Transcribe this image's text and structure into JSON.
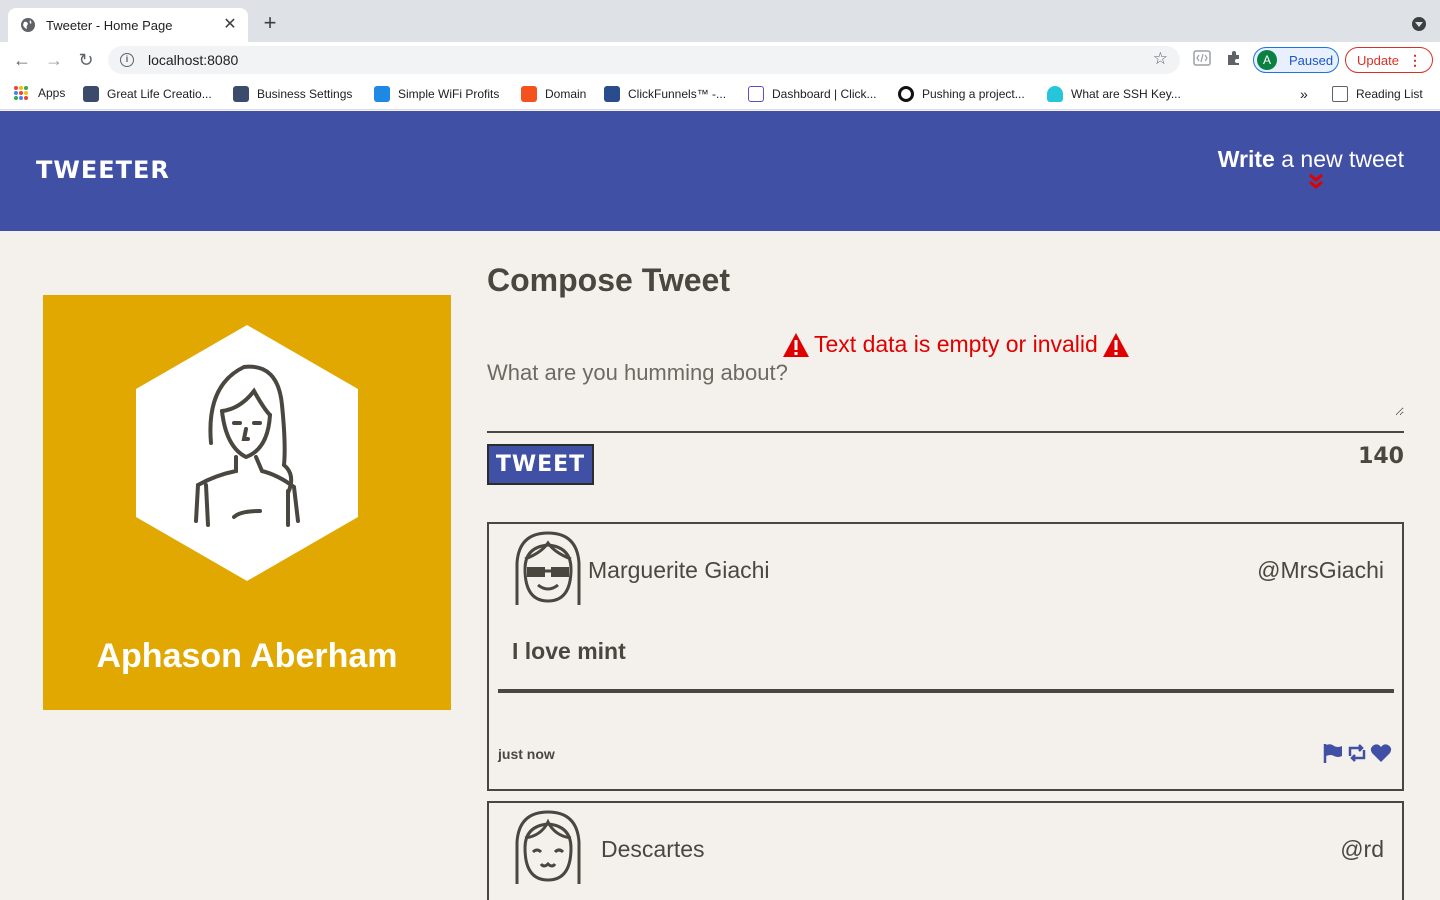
{
  "browser": {
    "tab_title": "Tweeter - Home Page",
    "url": "localhost:8080",
    "profile_initial": "A",
    "profile_status": "Paused",
    "update_label": "Update",
    "bookmarks": [
      {
        "label": "Apps"
      },
      {
        "label": "Great Life Creatio..."
      },
      {
        "label": "Business Settings"
      },
      {
        "label": "Simple WiFi Profits"
      },
      {
        "label": "Domain"
      },
      {
        "label": "ClickFunnels™ -..."
      },
      {
        "label": "Dashboard | Click..."
      },
      {
        "label": "Pushing a project..."
      },
      {
        "label": "What are SSH Key..."
      }
    ],
    "reading_list": "Reading List",
    "overflow": "»"
  },
  "nav": {
    "brand": "TWEETER",
    "write_bold": "Write",
    "write_rest": " a new tweet",
    "accent_color": "#4050a5"
  },
  "profile": {
    "name": "Aphason Aberham",
    "card_color": "#e0a800"
  },
  "compose": {
    "title": "Compose Tweet",
    "error": "Text data is empty or invalid",
    "placeholder": "What are you humming about?",
    "value": "",
    "button": "TWEET",
    "counter": "140",
    "error_color": "#e00000"
  },
  "tweets": [
    {
      "name": "Marguerite Giachi",
      "handle": "@MrsGiachi",
      "text": "I love mint",
      "time": "just now",
      "avatar_icon": "avatar-sunglasses-icon"
    },
    {
      "name": "Descartes",
      "handle": "@rd",
      "avatar_icon": "avatar-smile-icon"
    }
  ]
}
